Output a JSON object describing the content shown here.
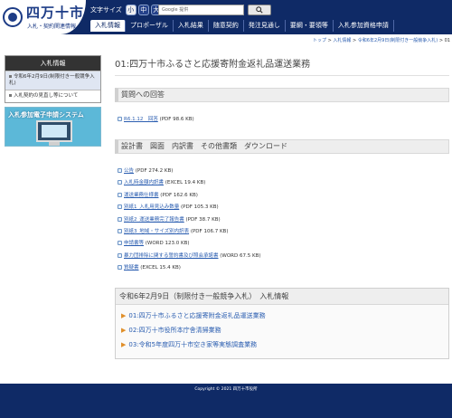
{
  "header": {
    "logo_name": "四万十市",
    "logo_sub": "入札・契約関連情報",
    "fontsize_label": "文字サイズ",
    "fontsize_options": [
      "小",
      "中",
      "大"
    ],
    "search_placeholder": "Google 提供"
  },
  "gnav": [
    "入札情報",
    "プロポーザル",
    "入札結果",
    "随意契約",
    "発注見通し",
    "要綱・要領等",
    "入札参加資格申請"
  ],
  "breadcrumb": {
    "home": "トップ",
    "sep": " > ",
    "l1": "入札情報",
    "l2": "令和6年2月9日(制限付き一般競争入札)",
    "current": "01"
  },
  "side": {
    "title": "入札情報",
    "items": [
      "令和6年2月9日(制限付き一般競争入札)",
      "入札契約の見直し等について"
    ]
  },
  "banner": {
    "text": "入札参加電子申請システム"
  },
  "main": {
    "page_title": "01:四万十市ふるさと応援寄附金返礼品運送業務",
    "qa_title": "質問への回答",
    "qa_files": [
      {
        "link": "R6.1.12　回答",
        "meta": " (PDF 98.6 KB)"
      }
    ],
    "docs_title": "設計書　図面　内訳書　その他書類　ダウンロード",
    "docs_files": [
      {
        "link": "公告",
        "meta": " (PDF 274.2 KB)"
      },
      {
        "link": "入札時金額内訳書",
        "meta": " (EXCEL 19.4 KB)"
      },
      {
        "link": "運送業務仕様書",
        "meta": " (PDF 162.6 KB)"
      },
      {
        "link": "別紙1_入札用見込み数量",
        "meta": " (PDF 105.3 KB)"
      },
      {
        "link": "別紙2_運送業務完了報告書",
        "meta": " (PDF 38.7 KB)"
      },
      {
        "link": "別紙3_地域・サイズ別内訳表",
        "meta": " (PDF 106.7 KB)"
      },
      {
        "link": "申請書等",
        "meta": " (WORD 123.0 KB)"
      },
      {
        "link": "暴力団排除に関する誓約書及び照会承諾書",
        "meta": " (WORD 67.5 KB)"
      },
      {
        "link": "質疑書",
        "meta": " (EXCEL 15.4 KB)"
      }
    ],
    "bid_title": "令和6年2月9日（制限付き一般競争入札）　入札情報",
    "bid_items": [
      "01:四万十市ふるさと応援寄附金返礼品運送業務",
      "02:四万十市役所本庁舎清掃業務",
      "03:令和5年度四万十市空き家等実態調査業務"
    ]
  },
  "footer": {
    "copyright": "Copyright © 2021 四万十市役所"
  },
  "colors": {
    "navy": "#0f2a66",
    "link": "#2a5db0",
    "accent_arrow": "#e08f2a"
  }
}
